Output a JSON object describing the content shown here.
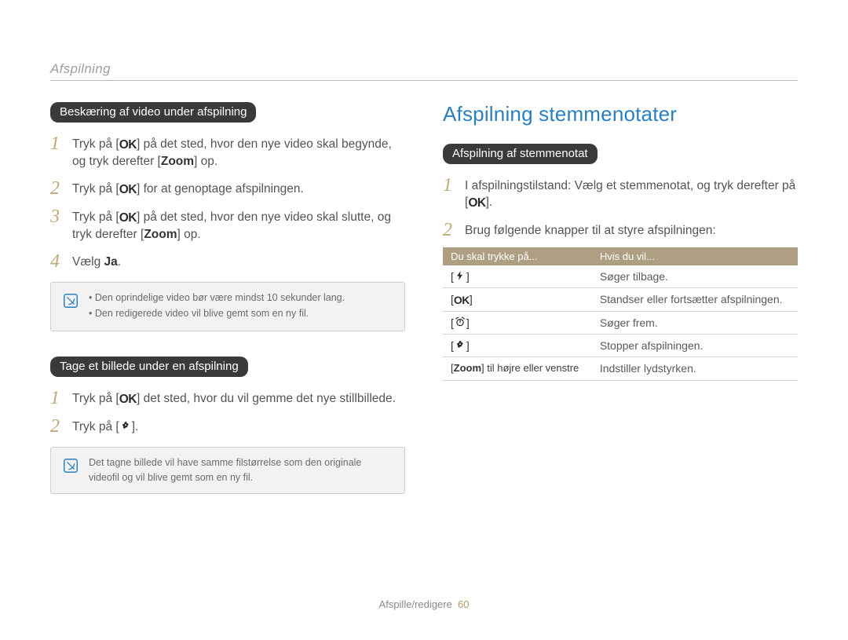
{
  "header": {
    "title": "Afspilning"
  },
  "left": {
    "sectionA": {
      "pill": "Beskæring af video under afspilning",
      "step1": {
        "num": "1",
        "pre": "Tryk på [",
        "post": "] på det sted, hvor den nye video skal begynde, og tryk derefter [",
        "bold": "Zoom",
        "tail": "] op."
      },
      "step2": {
        "num": "2",
        "pre": "Tryk på [",
        "post": "] for at genoptage afspilningen."
      },
      "step3": {
        "num": "3",
        "pre": "Tryk på [",
        "post": "] på det sted, hvor den nye video skal slutte, og tryk derefter [",
        "bold": "Zoom",
        "tail": "] op."
      },
      "step4": {
        "num": "4",
        "text": "Vælg ",
        "bold": "Ja",
        "tail": "."
      },
      "note1": "Den oprindelige video bør være mindst 10 sekunder lang.",
      "note2": "Den redigerede video vil blive gemt som en ny fil."
    },
    "sectionB": {
      "pill": "Tage et billede under en afspilning",
      "step1": {
        "num": "1",
        "pre": "Tryk på [",
        "post": "] det sted, hvor du vil gemme det nye stillbillede."
      },
      "step2": {
        "num": "2",
        "pre": "Tryk på [",
        "post": "]."
      },
      "note": "Det tagne billede vil have samme filstørrelse som den originale videofil og vil blive gemt som en ny fil."
    }
  },
  "right": {
    "heading": "Afspilning stemmenotater",
    "pill": "Afspilning af stemmenotat",
    "step1": {
      "num": "1",
      "pre": "I afspilningstilstand: Vælg et stemmenotat, og tryk derefter på [",
      "post": "]."
    },
    "step2": {
      "num": "2",
      "text": "Brug følgende knapper til at styre afspilningen:"
    },
    "table": {
      "th1": "Du skal trykke på...",
      "th2": "Hvis du vil...",
      "r1": {
        "a": "[",
        "b": "]",
        "desc": "Søger tilbage."
      },
      "r2": {
        "a": "[",
        "b": "]",
        "desc": "Standser eller fortsætter afspilningen."
      },
      "r3": {
        "a": "[",
        "b": "]",
        "desc": "Søger frem."
      },
      "r4": {
        "a": "[",
        "b": "]",
        "desc": "Stopper afspilningen."
      },
      "r5": {
        "pre": "[",
        "bold": "Zoom",
        "post": "] til højre eller venstre",
        "desc": "Indstiller lydstyrken."
      }
    }
  },
  "footer": {
    "text": "Afspille/redigere",
    "page": "60"
  },
  "icons": {
    "ok": "OK"
  }
}
